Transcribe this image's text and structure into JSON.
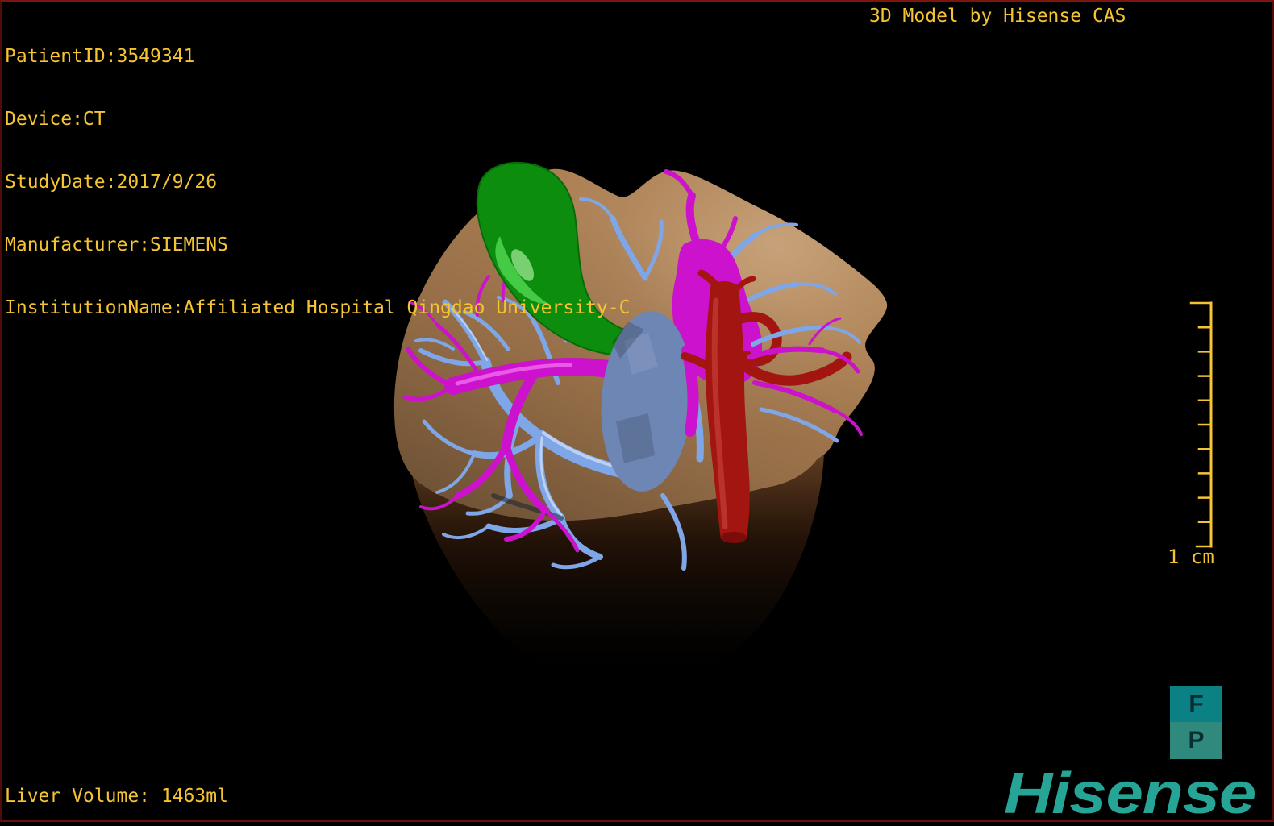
{
  "patient_info": {
    "lines": [
      "PatientID:3549341",
      "Device:CT",
      "StudyDate:2017/9/26",
      "Manufacturer:SIEMENS",
      "InstitutionName:Affiliated Hospital Qingdao University-C"
    ]
  },
  "watermark": "3D Model by Hisense CAS",
  "measurements": {
    "liver_volume": "Liver Volume: 1463ml"
  },
  "scale_bar": {
    "label": "1 cm",
    "divisions": 10
  },
  "orientation_cube": {
    "front": "F",
    "posterior": "P"
  },
  "branding": {
    "logo": "Hisense"
  },
  "colors": {
    "overlay_text": "#f4c433",
    "background": "#000000",
    "frame_border": "#6b100a",
    "liver": "#ab7e52",
    "liver_shadow_top": "#6b4526",
    "gallbladder": "#0d8d0d",
    "gallbladder_highlight": "#54da54",
    "hepatic_vein": "#7fa6e6",
    "portal_vessel": "#cc12cc",
    "venous_mass": "#6e86b4",
    "aorta": "#a31511",
    "aorta_highlight": "#cf4a40",
    "scale_bar": "#f4c433",
    "cube_front": "#0b8186",
    "cube_posterior": "#2f8a7d",
    "cube_letter": "#082e31",
    "logo": "#26a597"
  }
}
